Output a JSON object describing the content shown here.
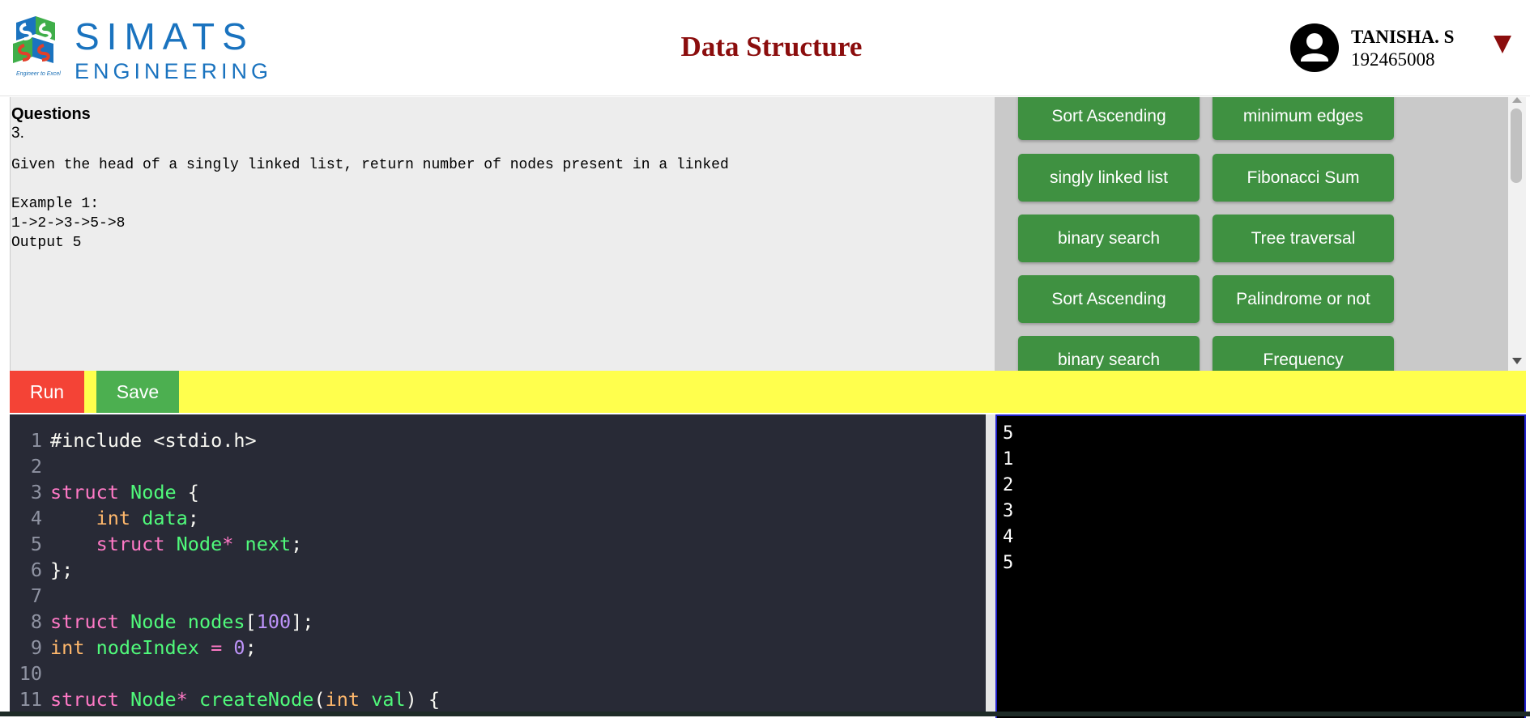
{
  "header": {
    "logo": {
      "name_top": "SIMATS",
      "name_bottom": "ENGINEERING",
      "tagline": "Engineer to Excel",
      "colors": {
        "blue": "#1a73bf",
        "green": "#3fae49",
        "red": "#e2402b"
      }
    },
    "title": "Data Structure",
    "user": {
      "name": "TANISHA. S",
      "id": "192465008",
      "avatar_icon": "user-avatar-icon",
      "menu_icon": "triangle-down-icon"
    }
  },
  "question": {
    "heading": "Questions",
    "number": "3.",
    "body": "Given the head of a singly linked list, return number of nodes present in a linked\n\nExample 1:\n1->2->3->5->8\nOutput 5"
  },
  "topics": [
    "Sort Ascending",
    "minimum edges",
    "singly linked list",
    "Fibonacci Sum",
    "binary search",
    "Tree traversal",
    "Sort Ascending",
    "Palindrome or not",
    "binary search",
    "Frequency"
  ],
  "toolbar": {
    "run_label": "Run",
    "save_label": "Save",
    "colors": {
      "run": "#f44336",
      "save": "#4caf50",
      "bar": "#ffff4d"
    }
  },
  "editor": {
    "lines": [
      {
        "n": "1",
        "tokens": [
          [
            "plain",
            "#include <stdio.h>"
          ]
        ]
      },
      {
        "n": "2",
        "tokens": []
      },
      {
        "n": "3",
        "tokens": [
          [
            "kw",
            "struct"
          ],
          [
            "plain",
            " "
          ],
          [
            "class",
            "Node"
          ],
          [
            "plain",
            " {"
          ]
        ]
      },
      {
        "n": "4",
        "tokens": [
          [
            "plain",
            "    "
          ],
          [
            "type",
            "int"
          ],
          [
            "plain",
            " "
          ],
          [
            "class",
            "data"
          ],
          [
            "plain",
            ";"
          ]
        ]
      },
      {
        "n": "5",
        "tokens": [
          [
            "plain",
            "    "
          ],
          [
            "kw",
            "struct"
          ],
          [
            "plain",
            " "
          ],
          [
            "class",
            "Node"
          ],
          [
            "op",
            "*"
          ],
          [
            "plain",
            " "
          ],
          [
            "class",
            "next"
          ],
          [
            "plain",
            ";"
          ]
        ]
      },
      {
        "n": "6",
        "tokens": [
          [
            "plain",
            "};"
          ]
        ]
      },
      {
        "n": "7",
        "tokens": []
      },
      {
        "n": "8",
        "tokens": [
          [
            "kw",
            "struct"
          ],
          [
            "plain",
            " "
          ],
          [
            "class",
            "Node"
          ],
          [
            "plain",
            " "
          ],
          [
            "class",
            "nodes"
          ],
          [
            "plain",
            "["
          ],
          [
            "num",
            "100"
          ],
          [
            "plain",
            "];"
          ]
        ]
      },
      {
        "n": "9",
        "tokens": [
          [
            "type",
            "int"
          ],
          [
            "plain",
            " "
          ],
          [
            "class",
            "nodeIndex"
          ],
          [
            "plain",
            " "
          ],
          [
            "op",
            "="
          ],
          [
            "plain",
            " "
          ],
          [
            "num",
            "0"
          ],
          [
            "plain",
            ";"
          ]
        ]
      },
      {
        "n": "10",
        "tokens": []
      },
      {
        "n": "11",
        "tokens": [
          [
            "kw",
            "struct"
          ],
          [
            "plain",
            " "
          ],
          [
            "class",
            "Node"
          ],
          [
            "op",
            "*"
          ],
          [
            "plain",
            " "
          ],
          [
            "class",
            "createNode"
          ],
          [
            "plain",
            "("
          ],
          [
            "type",
            "int"
          ],
          [
            "plain",
            " "
          ],
          [
            "param",
            "val"
          ],
          [
            "plain",
            ") {"
          ]
        ]
      }
    ]
  },
  "output": {
    "lines": [
      "5",
      "1",
      "2",
      "3",
      "4",
      "5"
    ]
  }
}
